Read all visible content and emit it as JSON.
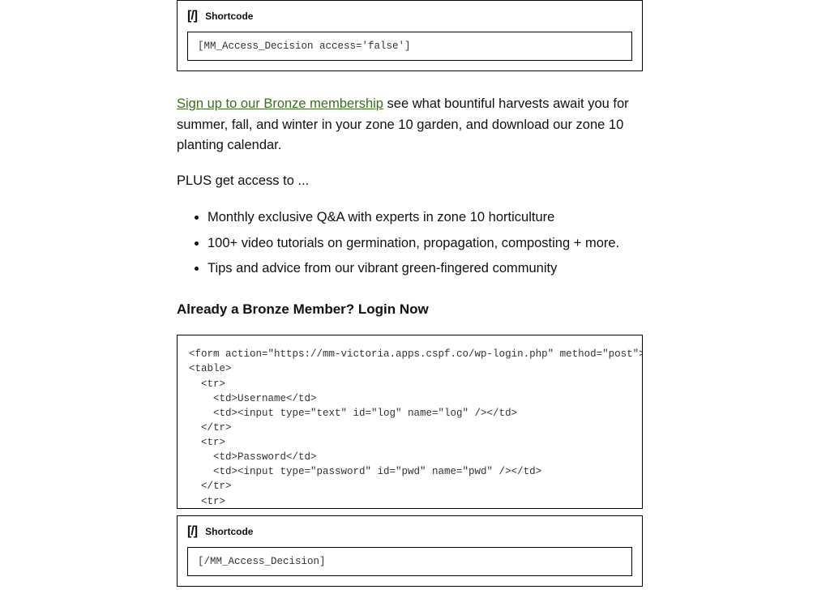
{
  "shortcode_block_1": {
    "icon_glyph": "[/]",
    "label": "Shortcode",
    "value": "[MM_Access_Decision access='false']"
  },
  "paragraph_1": {
    "link_text": "Sign up to our Bronze membership",
    "rest": " see what bountiful harvests await you for summer, fall, and winter in your zone 10 garden, and download our zone 10 planting calendar."
  },
  "paragraph_2": "PLUS get access to ...",
  "bullets": [
    "Monthly exclusive Q&A with experts in zone 10 horticulture",
    "100+ video tutorials on germination, propagation, composting + more.",
    "Tips and advice from our vibrant green-fingered community"
  ],
  "subhead": "Already a Bronze Member? Login Now",
  "code_block": "<form action=\"https://mm-victoria.apps.cspf.co/wp-login.php\" method=\"post\">\n<table>\n  <tr>\n    <td>Username</td>\n    <td><input type=\"text\" id=\"log\" name=\"log\" /></td>\n  </tr>\n  <tr>\n    <td>Password</td>\n    <td><input type=\"password\" id=\"pwd\" name=\"pwd\" /></td>\n  </tr>\n  <tr>",
  "shortcode_block_2": {
    "icon_glyph": "[/]",
    "label": "Shortcode",
    "value": "[/MM_Access_Decision]"
  }
}
